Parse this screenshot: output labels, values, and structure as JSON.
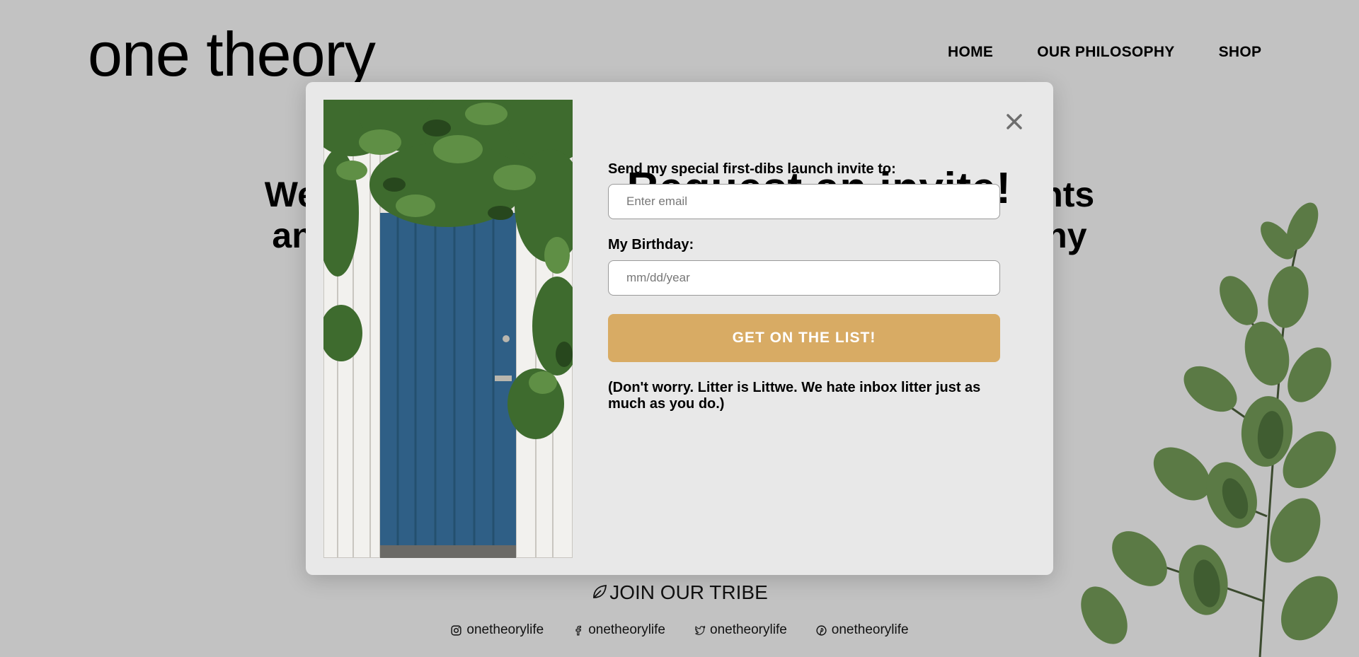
{
  "site": {
    "logo": "one theory",
    "nav": [
      "HOME",
      "OUR PHILOSOPHY",
      "SHOP"
    ]
  },
  "hero": {
    "line1_start": "We of",
    "line1_end": "plants",
    "line2_start": "and e",
    "line2_end": "n any"
  },
  "modal": {
    "title": "Request an invite!",
    "email_label": "Send my special first-dibs launch invite to:",
    "email_placeholder": "Enter email",
    "birthday_label": "My Birthday:",
    "birthday_placeholder": "mm/dd/year",
    "cta_label": "GET ON THE LIST!",
    "note": "(Don't worry. Litter is Littwe. We hate inbox litter just as much as you do.)",
    "close_icon": "close-icon",
    "cta_color": "#d8ab64"
  },
  "footer": {
    "tribe": "JOIN OUR TRIBE",
    "socials": [
      {
        "icon": "instagram-icon",
        "handle": "onetheorylife"
      },
      {
        "icon": "facebook-icon",
        "handle": "onetheorylife"
      },
      {
        "icon": "twitter-icon",
        "handle": "onetheorylife"
      },
      {
        "icon": "pinterest-icon",
        "handle": "onetheorylife"
      }
    ]
  }
}
